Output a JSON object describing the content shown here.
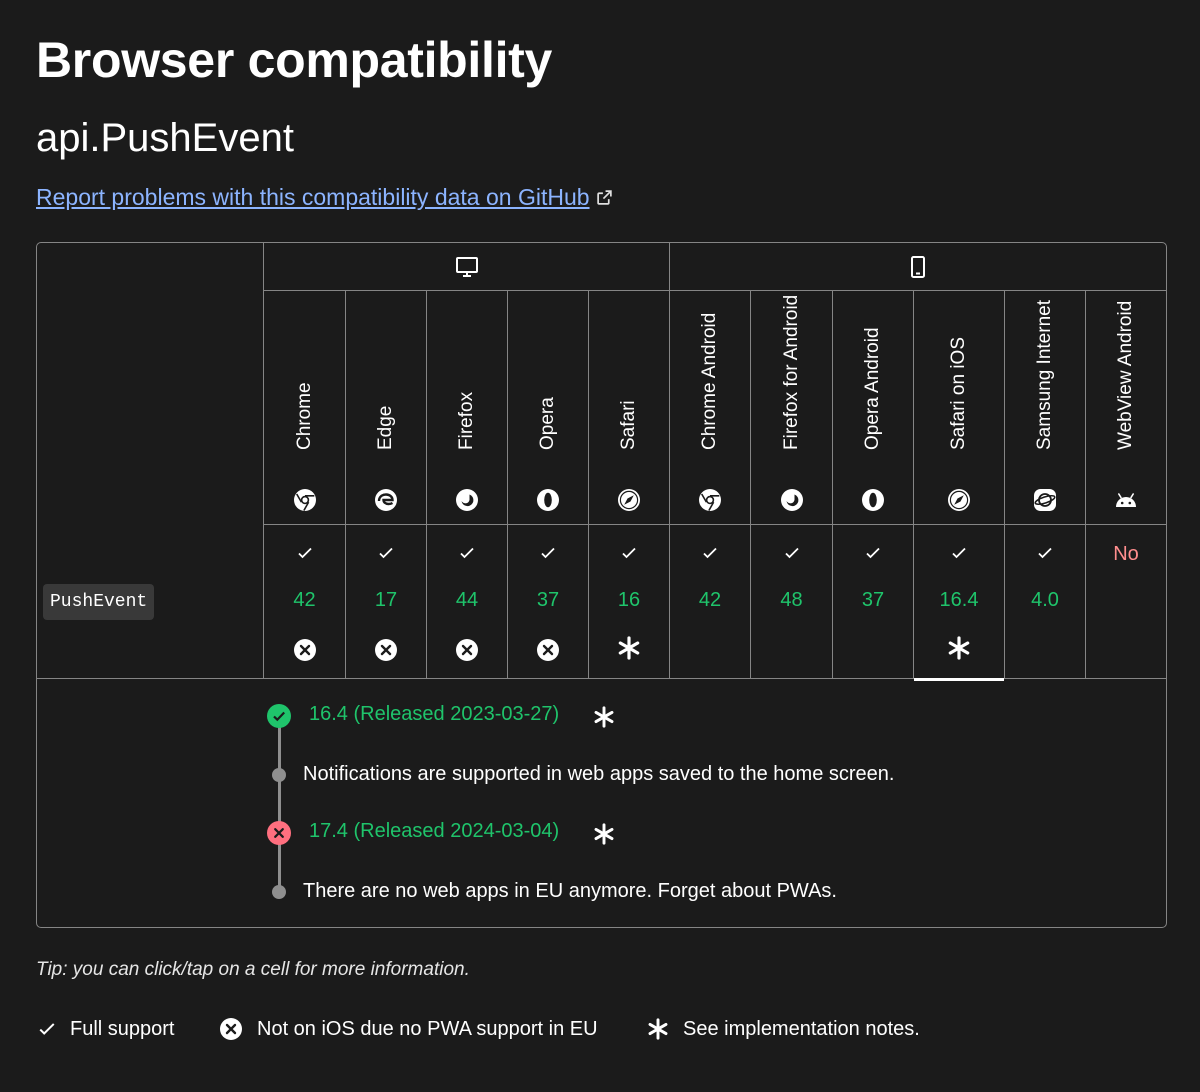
{
  "page": {
    "title": "Browser compatibility",
    "subtitle": "api.PushEvent",
    "report_link": "Report problems with this compatibility data on GitHub"
  },
  "platforms": [
    {
      "name": "desktop",
      "icon": "desktop-icon"
    },
    {
      "name": "mobile",
      "icon": "mobile-icon"
    }
  ],
  "browsers": [
    {
      "name": "Chrome",
      "icon": "chrome-icon"
    },
    {
      "name": "Edge",
      "icon": "edge-icon"
    },
    {
      "name": "Firefox",
      "icon": "firefox-icon"
    },
    {
      "name": "Opera",
      "icon": "opera-icon"
    },
    {
      "name": "Safari",
      "icon": "safari-icon"
    },
    {
      "name": "Chrome Android",
      "icon": "chrome-icon"
    },
    {
      "name": "Firefox for Android",
      "icon": "firefox-icon"
    },
    {
      "name": "Opera Android",
      "icon": "opera-icon"
    },
    {
      "name": "Safari on iOS",
      "icon": "safari-icon"
    },
    {
      "name": "Samsung Internet",
      "icon": "samsung-internet-icon"
    },
    {
      "name": "WebView Android",
      "icon": "android-icon"
    }
  ],
  "feature": {
    "name": "PushEvent",
    "support": [
      {
        "version": "42",
        "full": true,
        "flag": "x"
      },
      {
        "version": "17",
        "full": true,
        "flag": "x"
      },
      {
        "version": "44",
        "full": true,
        "flag": "x"
      },
      {
        "version": "37",
        "full": true,
        "flag": "x"
      },
      {
        "version": "16",
        "full": true,
        "flag": "star"
      },
      {
        "version": "42",
        "full": true,
        "flag": ""
      },
      {
        "version": "48",
        "full": true,
        "flag": ""
      },
      {
        "version": "37",
        "full": true,
        "flag": ""
      },
      {
        "version": "16.4",
        "full": true,
        "flag": "star",
        "active": true
      },
      {
        "version": "4.0",
        "full": true,
        "flag": ""
      },
      {
        "version": "No",
        "full": false,
        "flag": ""
      }
    ]
  },
  "timeline": [
    {
      "version": "16.4 (Released 2023-03-27)",
      "status": "supported",
      "note": "Notifications are supported in web apps saved to the home screen."
    },
    {
      "version": "17.4 (Released 2024-03-04)",
      "status": "removed",
      "note": "There are no web apps in EU anymore. Forget about PWAs."
    }
  ],
  "tip": "Tip: you can click/tap on a cell for more information.",
  "legend": {
    "full_support": "Full support",
    "not_on_ios": "Not on iOS due no PWA support in EU",
    "see_notes": "See implementation notes."
  },
  "colors": {
    "background": "#1b1b1b",
    "support_green": "#1fc46b",
    "no_support_red": "#ff8e8e",
    "link_blue": "#8cb4ff",
    "border": "#858585"
  }
}
